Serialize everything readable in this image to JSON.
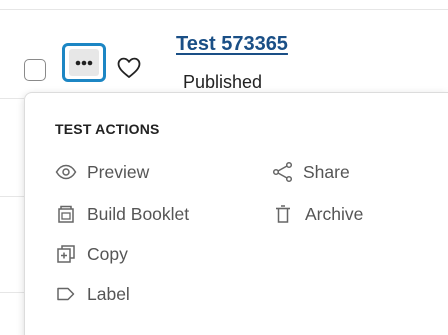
{
  "test_row": {
    "title": "Test 573365",
    "status": "Published"
  },
  "icons": {
    "checkbox": "checkbox-icon",
    "more": "ellipsis-icon",
    "favorite": "heart-icon"
  },
  "colors": {
    "link": "#1a4f86",
    "focus_ring": "#1c86c4",
    "muted_text": "#555555"
  },
  "menu": {
    "heading": "TEST ACTIONS",
    "items": [
      {
        "label": "Preview",
        "icon": "eye-icon"
      },
      {
        "label": "Share",
        "icon": "share-icon"
      },
      {
        "label": "Build Booklet",
        "icon": "booklet-icon"
      },
      {
        "label": "Archive",
        "icon": "trash-icon"
      },
      {
        "label": "Copy",
        "icon": "copy-icon"
      },
      {
        "label": "Label",
        "icon": "tag-icon"
      }
    ]
  }
}
